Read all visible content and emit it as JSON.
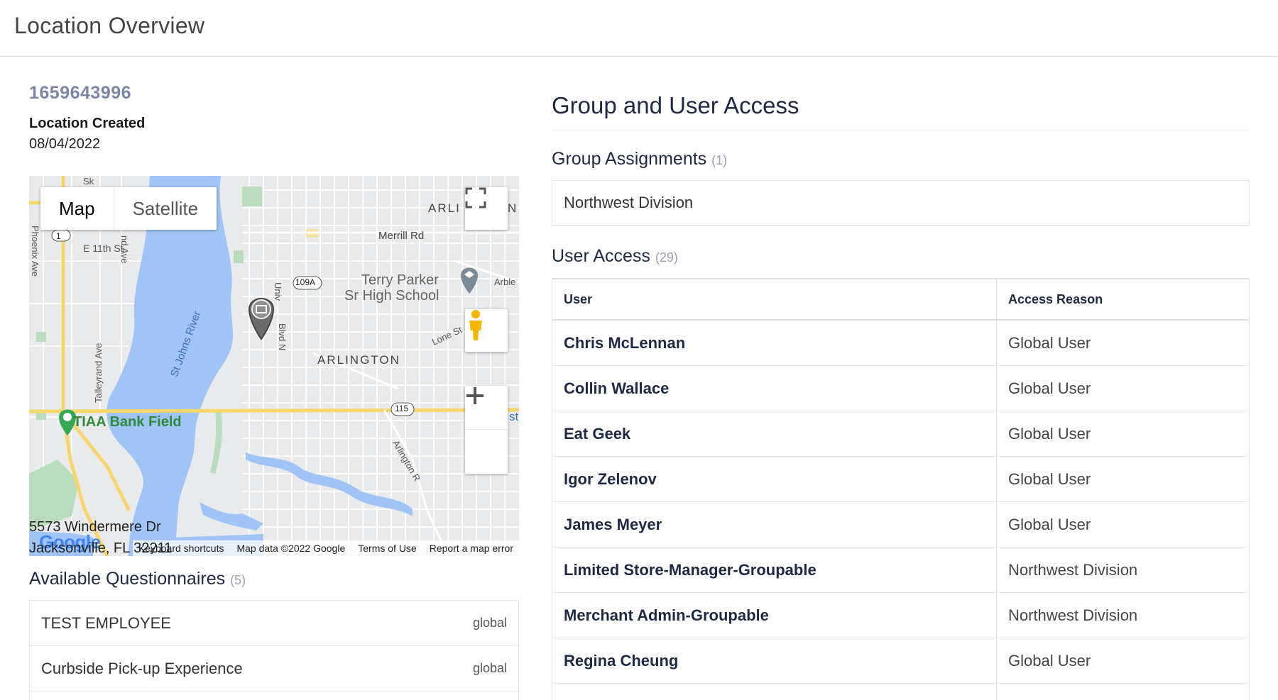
{
  "header": {
    "title": "Location Overview"
  },
  "location": {
    "id": "1659643996",
    "created_label": "Location Created",
    "created_date": "08/04/2022",
    "address_line1": "5573 Windermere Dr",
    "address_line2": "Jacksonville, FL 32211"
  },
  "map": {
    "type_map": "Map",
    "type_satellite": "Satellite",
    "labels": {
      "arlington_top": "ARLI",
      "arlington_top_right": "N",
      "merrill": "Merrill Rd",
      "terry1": "Terry Parker",
      "terry2": "Sr High School",
      "arble": "Arble",
      "e11th": "E 11th St",
      "phoenix": "Phoenix Ave",
      "ndave": "nd Ave",
      "route1": "1",
      "route109a": "109A",
      "route115": "115",
      "univ": "Univ",
      "blvdn": "Blvd N",
      "lone": "Lone St",
      "arlington": "ARLINGTON",
      "stjohns": "St Johns River",
      "talleyrand": "Talleyrand Ave",
      "tiaa": "TIAA Bank Field",
      "arlington_rd": "Arlington R",
      "sk": "Sk",
      "st": "st"
    },
    "footer": {
      "keyboard": "Keyboard shortcuts",
      "data": "Map data ©2022 Google",
      "terms": "Terms of Use",
      "report": "Report a map error"
    },
    "logo": "Google"
  },
  "questionnaires": {
    "title": "Available Questionnaires",
    "count": "(5)",
    "items": [
      {
        "name": "TEST EMPLOYEE",
        "scope": "global"
      },
      {
        "name": "Curbside Pick-up Experience",
        "scope": "global"
      }
    ]
  },
  "access": {
    "title": "Group and User Access",
    "groups_title": "Group Assignments",
    "groups_count": "(1)",
    "groups": [
      "Northwest Division"
    ],
    "users_title": "User Access",
    "users_count": "(29)",
    "col_user": "User",
    "col_reason": "Access Reason",
    "users": [
      {
        "user": "Chris McLennan",
        "reason": "Global User"
      },
      {
        "user": "Collin Wallace",
        "reason": "Global User"
      },
      {
        "user": "Eat Geek",
        "reason": "Global User"
      },
      {
        "user": "Igor Zelenov",
        "reason": "Global User"
      },
      {
        "user": "James Meyer",
        "reason": "Global User"
      },
      {
        "user": "Limited Store-Manager-Groupable",
        "reason": "Northwest Division"
      },
      {
        "user": "Merchant Admin-Groupable",
        "reason": "Northwest Division"
      },
      {
        "user": "Regina Cheung",
        "reason": "Global User"
      }
    ]
  },
  "colors": {
    "water": "#9fc4f5",
    "park": "#b8dcbc",
    "highway": "#f7d66b",
    "road": "#ffffff",
    "accent_id": "#7a86a8",
    "heading": "#1e2a44"
  }
}
